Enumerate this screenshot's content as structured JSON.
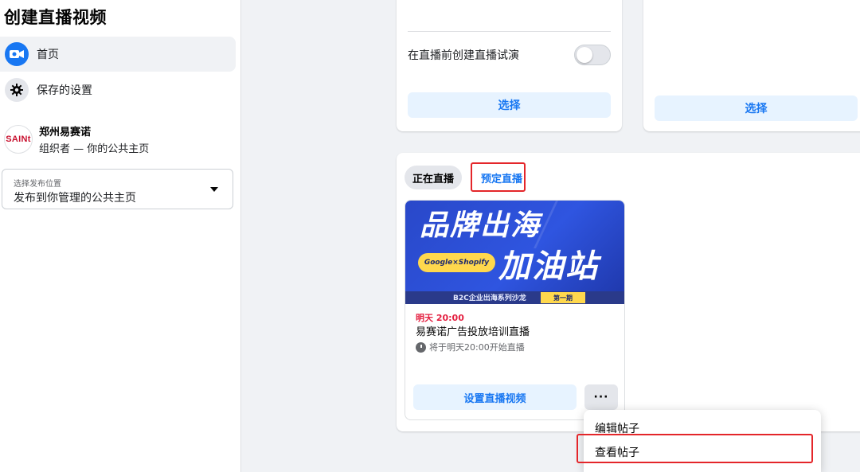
{
  "sidebar": {
    "title": "创建直播视频",
    "items": [
      {
        "label": "首页",
        "icon": "video-camera-icon"
      },
      {
        "label": "保存的设置",
        "icon": "gear-icon"
      }
    ],
    "page": {
      "logo_text": "SAINt",
      "name": "郑州易赛诺",
      "role": "组织者 — 你的公共主页"
    },
    "post_location": {
      "label": "选择发布位置",
      "value": "发布到你管理的公共主页"
    }
  },
  "setup": {
    "rehearsal_label": "在直播前创建直播试演",
    "rehearsal_enabled": false,
    "choose_label": "选择",
    "choose_label_2": "选择"
  },
  "live": {
    "tabs": [
      {
        "label": "正在直播",
        "active": true
      },
      {
        "label": "预定直播",
        "active": false
      }
    ],
    "video": {
      "thumb_headline_1": "品牌出海",
      "thumb_headline_2": "加油站",
      "thumb_pill": "Google×Shopify",
      "thumb_strip": "B2C企业出海系列沙龙",
      "thumb_badge": "第一期",
      "time": "明天 20:00",
      "title": "易赛诺广告投放培训直播",
      "status": "将于明天20:00开始直播",
      "setup_button": "设置直播视频",
      "more_button": "···"
    }
  },
  "menu": {
    "items": [
      "编辑帖子",
      "查看帖子"
    ]
  },
  "colors": {
    "accent": "#1877f2",
    "accent_soft": "#e7f3ff",
    "highlight_box": "#e4262a",
    "time_red": "#e41e3f"
  }
}
